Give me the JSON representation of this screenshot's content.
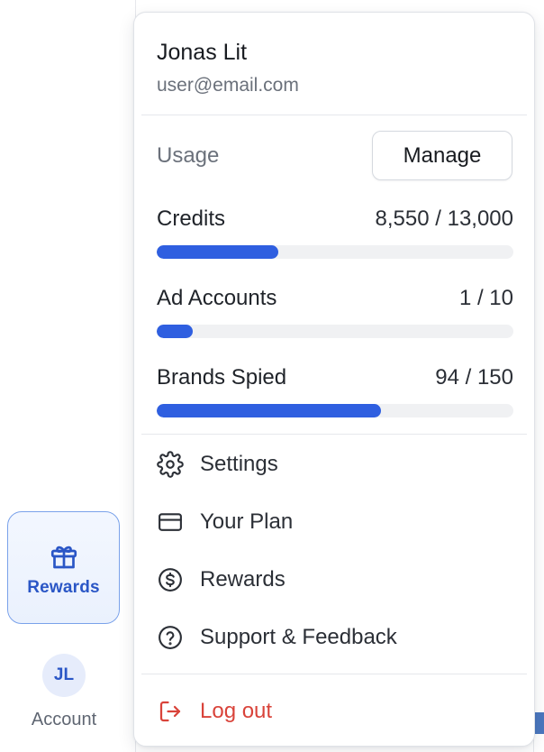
{
  "sidebar": {
    "rewards_label": "Rewards",
    "account_initials": "JL",
    "account_label": "Account"
  },
  "menu": {
    "user_name": "Jonas Lit",
    "user_email": "user@email.com",
    "usage_label": "Usage",
    "manage_label": "Manage",
    "meters": [
      {
        "name": "Credits",
        "value_text": "8,550 / 13,000",
        "used": 8550,
        "total": 13000,
        "fill_fraction": 0.34
      },
      {
        "name": "Ad Accounts",
        "value_text": "1 / 10",
        "used": 1,
        "total": 10,
        "fill_fraction": 0.1
      },
      {
        "name": "Brands Spied",
        "value_text": "94 / 150",
        "used": 94,
        "total": 150,
        "fill_fraction": 0.63
      }
    ],
    "items": [
      {
        "label": "Settings",
        "icon": "gear-icon"
      },
      {
        "label": "Your Plan",
        "icon": "credit-card-icon"
      },
      {
        "label": "Rewards",
        "icon": "dollar-circle-icon"
      },
      {
        "label": "Support & Feedback",
        "icon": "help-circle-icon"
      }
    ],
    "logout_label": "Log out",
    "logout_icon": "logout-icon"
  },
  "colors": {
    "accent": "#2f5fe0",
    "danger": "#d9433a",
    "rewards_border": "#7aa2ea"
  }
}
